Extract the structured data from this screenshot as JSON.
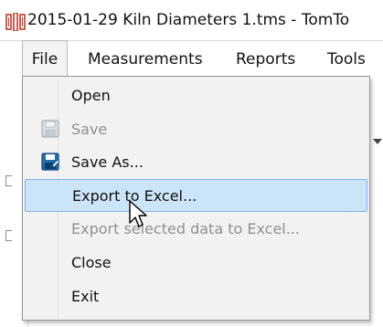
{
  "window": {
    "title": "2015-01-29 Kiln Diameters 1.tms - TomTo"
  },
  "menubar": {
    "items": [
      {
        "label": "File"
      },
      {
        "label": "Measurements"
      },
      {
        "label": "Reports"
      },
      {
        "label": "Tools"
      }
    ]
  },
  "file_menu": {
    "items": [
      {
        "label": "Open",
        "enabled": true,
        "icon": null
      },
      {
        "label": "Save",
        "enabled": false,
        "icon": "floppy-disk-icon"
      },
      {
        "label": "Save As...",
        "enabled": true,
        "icon": "save-as-icon"
      },
      {
        "label": "Export to Excel...",
        "enabled": true,
        "highlighted": true,
        "icon": null
      },
      {
        "label": "Export selected data to Excel...",
        "enabled": false,
        "icon": null
      },
      {
        "label": "Close",
        "enabled": true,
        "icon": null
      },
      {
        "label": "Exit",
        "enabled": true,
        "icon": null
      }
    ]
  },
  "colors": {
    "highlight_bg": "#cce4f7",
    "highlight_border": "#7fb3e6",
    "menu_bg": "#f2f2f2",
    "disabled_text": "#8f8f8f",
    "app_icon_red": "#c0392b"
  }
}
